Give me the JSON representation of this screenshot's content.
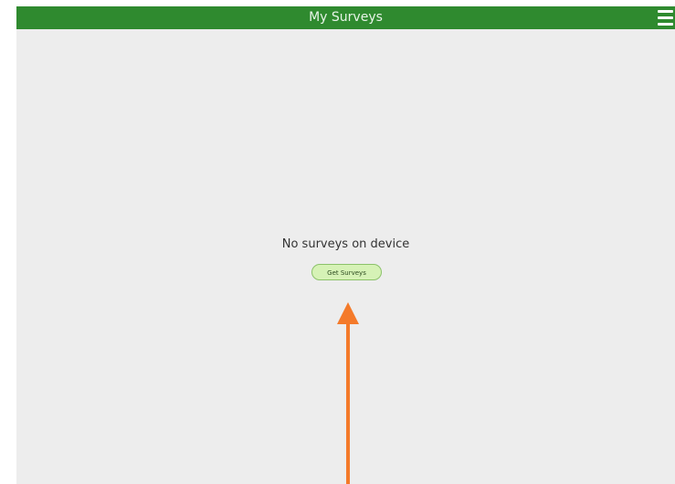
{
  "header": {
    "title": "My Surveys",
    "menu_icon": "hamburger-menu-icon"
  },
  "empty_state": {
    "message": "No surveys on device",
    "button_label": "Get Surveys"
  },
  "colors": {
    "header_bg": "#2f8a2f",
    "page_bg": "#ededed",
    "button_bg": "#d6f2b6",
    "arrow": "#f47a2a"
  },
  "annotation": {
    "icon": "arrow-up-icon"
  }
}
